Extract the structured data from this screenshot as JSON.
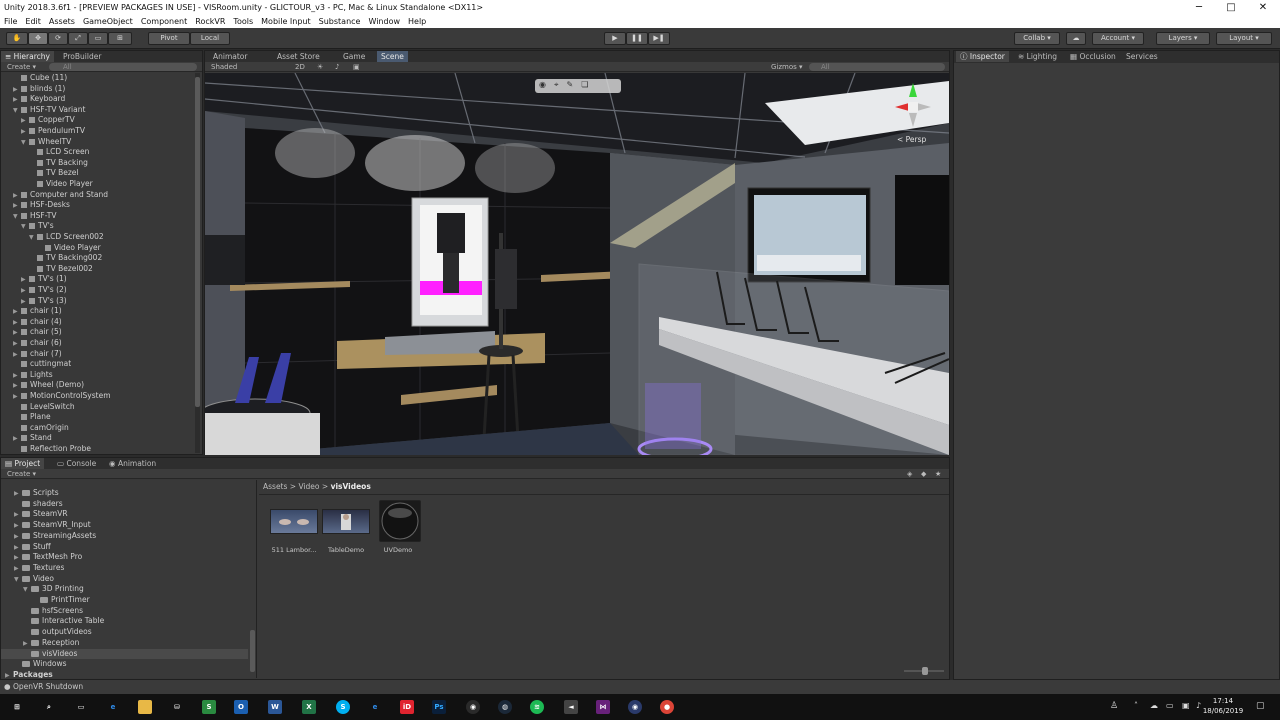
{
  "window": {
    "title": "Unity 2018.3.6f1 - [PREVIEW PACKAGES IN USE] - VISRoom.unity - GLICTOUR_v3 - PC, Mac & Linux Standalone <DX11>",
    "minimize": "─",
    "maximize": "□",
    "close": "✕"
  },
  "menu": [
    "File",
    "Edit",
    "Assets",
    "GameObject",
    "Component",
    "RockVR",
    "Tools",
    "Mobile Input",
    "Substance",
    "Window",
    "Help"
  ],
  "toolbar": {
    "pivot": "Pivot",
    "local": "Local",
    "collab": "Collab ▾",
    "account": "Account ▾",
    "layers": "Layers ▾",
    "layout": "Layout ▾",
    "play_icon": "play-icon",
    "pause_icon": "pause-icon",
    "step_icon": "step-icon"
  },
  "hierarchy": {
    "tab_hierarchy": "Hierarchy",
    "tab_probuilder": "ProBuilder",
    "create": "Create ▾",
    "search_placeholder": "All",
    "items": [
      {
        "label": "Cube (11)",
        "indent": 1,
        "tri": ""
      },
      {
        "label": "blinds (1)",
        "indent": 1,
        "tri": "▶"
      },
      {
        "label": "Keyboard",
        "indent": 1,
        "tri": "▶"
      },
      {
        "label": "HSF-TV Variant",
        "indent": 1,
        "tri": "▼"
      },
      {
        "label": "CopperTV",
        "indent": 2,
        "tri": "▶"
      },
      {
        "label": "PendulumTV",
        "indent": 2,
        "tri": "▶"
      },
      {
        "label": "WheelTV",
        "indent": 2,
        "tri": "▼"
      },
      {
        "label": "LCD Screen",
        "indent": 3,
        "tri": ""
      },
      {
        "label": "TV Backing",
        "indent": 3,
        "tri": ""
      },
      {
        "label": "TV Bezel",
        "indent": 3,
        "tri": ""
      },
      {
        "label": "Video Player",
        "indent": 3,
        "tri": ""
      },
      {
        "label": "Computer and Stand",
        "indent": 1,
        "tri": "▶"
      },
      {
        "label": "HSF-Desks",
        "indent": 1,
        "tri": "▶"
      },
      {
        "label": "HSF-TV",
        "indent": 1,
        "tri": "▼"
      },
      {
        "label": "TV's",
        "indent": 2,
        "tri": "▼"
      },
      {
        "label": "LCD Screen002",
        "indent": 3,
        "tri": "▼"
      },
      {
        "label": "Video Player",
        "indent": 4,
        "tri": ""
      },
      {
        "label": "TV Backing002",
        "indent": 3,
        "tri": ""
      },
      {
        "label": "TV Bezel002",
        "indent": 3,
        "tri": ""
      },
      {
        "label": "TV's (1)",
        "indent": 2,
        "tri": "▶"
      },
      {
        "label": "TV's (2)",
        "indent": 2,
        "tri": "▶"
      },
      {
        "label": "TV's (3)",
        "indent": 2,
        "tri": "▶"
      },
      {
        "label": "chair (1)",
        "indent": 1,
        "tri": "▶"
      },
      {
        "label": "chair (4)",
        "indent": 1,
        "tri": "▶"
      },
      {
        "label": "chair (5)",
        "indent": 1,
        "tri": "▶"
      },
      {
        "label": "chair (6)",
        "indent": 1,
        "tri": "▶"
      },
      {
        "label": "chair (7)",
        "indent": 1,
        "tri": "▶"
      },
      {
        "label": "cuttingmat",
        "indent": 1,
        "tri": ""
      },
      {
        "label": "Lights",
        "indent": 1,
        "tri": "▶"
      },
      {
        "label": "Wheel (Demo)",
        "indent": 1,
        "tri": "▶"
      },
      {
        "label": "MotionControlSystem",
        "indent": 1,
        "tri": "▶"
      },
      {
        "label": "LevelSwitch",
        "indent": 1,
        "tri": ""
      },
      {
        "label": "Plane",
        "indent": 1,
        "tri": ""
      },
      {
        "label": "camOrigin",
        "indent": 1,
        "tri": ""
      },
      {
        "label": "Stand",
        "indent": 1,
        "tri": "▶"
      },
      {
        "label": "Reflection Probe",
        "indent": 1,
        "tri": ""
      }
    ]
  },
  "scene": {
    "tab_animator": "Animator",
    "tab_asset_store": "Asset Store",
    "tab_game": "Game",
    "tab_scene": "Scene",
    "shaded": "Shaded",
    "mode_2d": "2D",
    "gizmos": "Gizmos ▾",
    "search_placeholder": "All",
    "persp": "< Persp"
  },
  "inspector": {
    "tab_inspector": "Inspector",
    "tab_lighting": "Lighting",
    "tab_occlusion": "Occlusion",
    "tab_services": "Services"
  },
  "project": {
    "tab_project": "Project",
    "tab_console": "Console",
    "tab_animation": "Animation",
    "create": "Create ▾",
    "breadcrumb": [
      "Assets",
      "Video",
      "visVideos"
    ],
    "tree": [
      {
        "label": "Scripts",
        "indent": 1,
        "tri": "▶"
      },
      {
        "label": "shaders",
        "indent": 1,
        "tri": ""
      },
      {
        "label": "SteamVR",
        "indent": 1,
        "tri": "▶"
      },
      {
        "label": "SteamVR_Input",
        "indent": 1,
        "tri": "▶"
      },
      {
        "label": "StreamingAssets",
        "indent": 1,
        "tri": "▶"
      },
      {
        "label": "Stuff",
        "indent": 1,
        "tri": "▶"
      },
      {
        "label": "TextMesh Pro",
        "indent": 1,
        "tri": "▶"
      },
      {
        "label": "Textures",
        "indent": 1,
        "tri": "▶"
      },
      {
        "label": "Video",
        "indent": 1,
        "tri": "▼"
      },
      {
        "label": "3D Printing",
        "indent": 2,
        "tri": "▼"
      },
      {
        "label": "PrintTimer",
        "indent": 3,
        "tri": ""
      },
      {
        "label": "hsfScreens",
        "indent": 2,
        "tri": ""
      },
      {
        "label": "Interactive Table",
        "indent": 2,
        "tri": ""
      },
      {
        "label": "outputVideos",
        "indent": 2,
        "tri": ""
      },
      {
        "label": "Reception",
        "indent": 2,
        "tri": "▶"
      },
      {
        "label": "visVideos",
        "indent": 2,
        "tri": ""
      },
      {
        "label": "Windows",
        "indent": 1,
        "tri": ""
      },
      {
        "label": "Packages",
        "indent": 0,
        "tri": "▶"
      }
    ],
    "assets": [
      {
        "label": "511 Lambor..."
      },
      {
        "label": "TableDemo"
      },
      {
        "label": "UVDemo"
      }
    ]
  },
  "status": {
    "text": "OpenVR Shutdown"
  },
  "taskbar": {
    "time": "17:14",
    "date": "18/06/2019"
  },
  "colors": {
    "accent": "#3d78c6",
    "panel": "#383838",
    "magenta": "#ff20ff"
  }
}
